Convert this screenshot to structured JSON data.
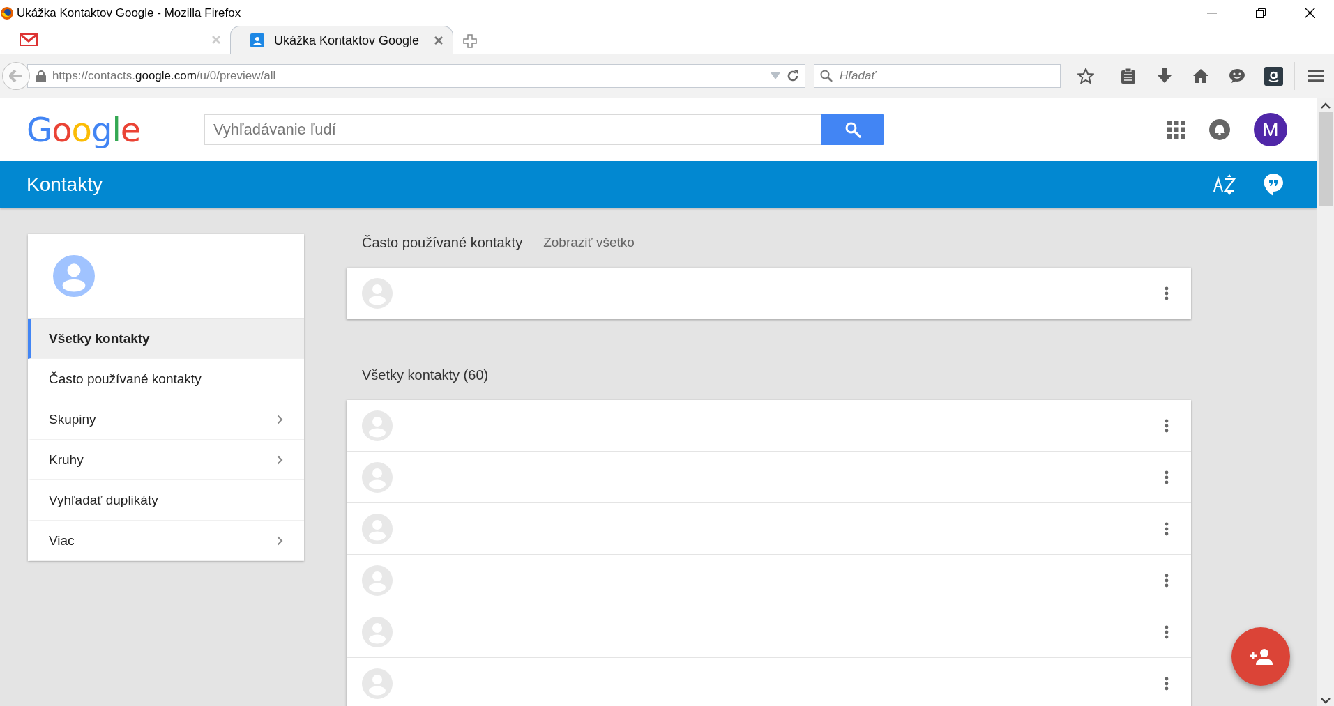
{
  "window": {
    "title": "Ukážka Kontaktov Google - Mozilla Firefox"
  },
  "tabs": [
    {
      "kind": "mail",
      "selected": false
    },
    {
      "kind": "contacts",
      "label": "Ukážka Kontaktov Google",
      "selected": true
    }
  ],
  "address_bar": {
    "prefix": "https://contacts.",
    "domain": "google.com",
    "path": "/u/0/preview/all"
  },
  "browser_search": {
    "placeholder": "Hľadať"
  },
  "header": {
    "logo": "Google",
    "search": {
      "placeholder": "Vyhľadávanie ľudí"
    },
    "account_initial": "M"
  },
  "app_bar": {
    "title": "Kontakty"
  },
  "sidebar": {
    "items": [
      {
        "label": "Všetky kontakty",
        "selected": true,
        "expandable": false
      },
      {
        "label": "Často používané kontakty",
        "selected": false,
        "expandable": false
      },
      {
        "label": "Skupiny",
        "selected": false,
        "expandable": true
      },
      {
        "label": "Kruhy",
        "selected": false,
        "expandable": true
      },
      {
        "label": "Vyhľadať duplikáty",
        "selected": false,
        "expandable": false
      },
      {
        "label": "Viac",
        "selected": false,
        "expandable": true
      }
    ]
  },
  "sections": [
    {
      "title": "Často používané kontakty",
      "link": "Zobraziť všetko",
      "rows": [
        {
          "kind": "contact"
        }
      ]
    },
    {
      "title": "Všetky kontakty (60)",
      "rows": [
        {
          "kind": "contact"
        },
        {
          "kind": "contact"
        },
        {
          "kind": "contact"
        },
        {
          "kind": "contact"
        },
        {
          "kind": "contact"
        },
        {
          "kind": "contact"
        }
      ]
    }
  ]
}
